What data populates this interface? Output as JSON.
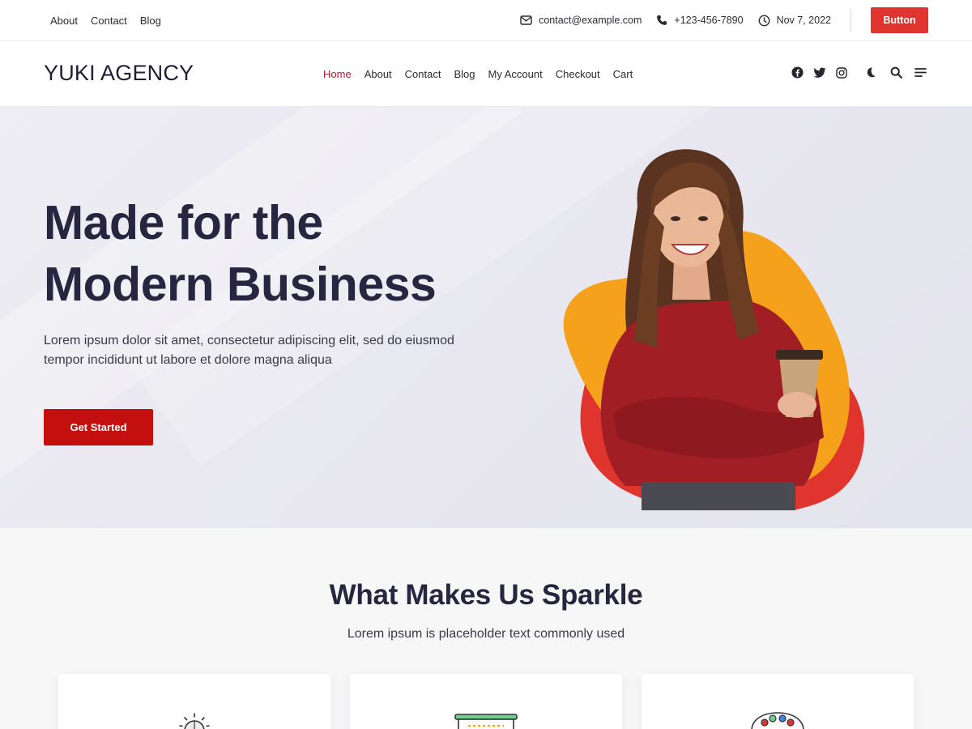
{
  "topbar": {
    "links": [
      "About",
      "Contact",
      "Blog"
    ],
    "email": "contact@example.com",
    "phone": "+123-456-7890",
    "date": "Nov 7, 2022",
    "button_label": "Button",
    "icons": [
      "envelope-icon",
      "phone-icon",
      "clock-icon"
    ]
  },
  "header": {
    "logo": "YUKI AGENCY",
    "nav": [
      "Home",
      "About",
      "Contact",
      "Blog",
      "My Account",
      "Checkout",
      "Cart"
    ],
    "active_nav": "Home",
    "social_icons": [
      "facebook-icon",
      "twitter-icon",
      "instagram-icon"
    ],
    "tool_icons": [
      "moon-icon",
      "search-icon",
      "menu-icon"
    ]
  },
  "hero": {
    "title_line1": "Made for the",
    "title_line2": "Modern Business",
    "description": "Lorem ipsum dolor sit amet, consectetur adipiscing elit, sed do eiusmod tempor incididunt ut labore et dolore magna aliqua",
    "cta_label": "Get Started"
  },
  "features": {
    "title": "What Makes Us Sparkle",
    "subtitle": "Lorem ipsum is placeholder text commonly used",
    "card_icons": [
      "lightbulb-icon",
      "presentation-board-icon",
      "palette-icon"
    ]
  },
  "colors": {
    "accent": "#e0342f",
    "cta": "#c40f0f",
    "nav_active": "#c8102e",
    "heading": "#262640",
    "hero_blob_yellow": "#f5a11c",
    "hero_blob_red": "#e0342f"
  }
}
